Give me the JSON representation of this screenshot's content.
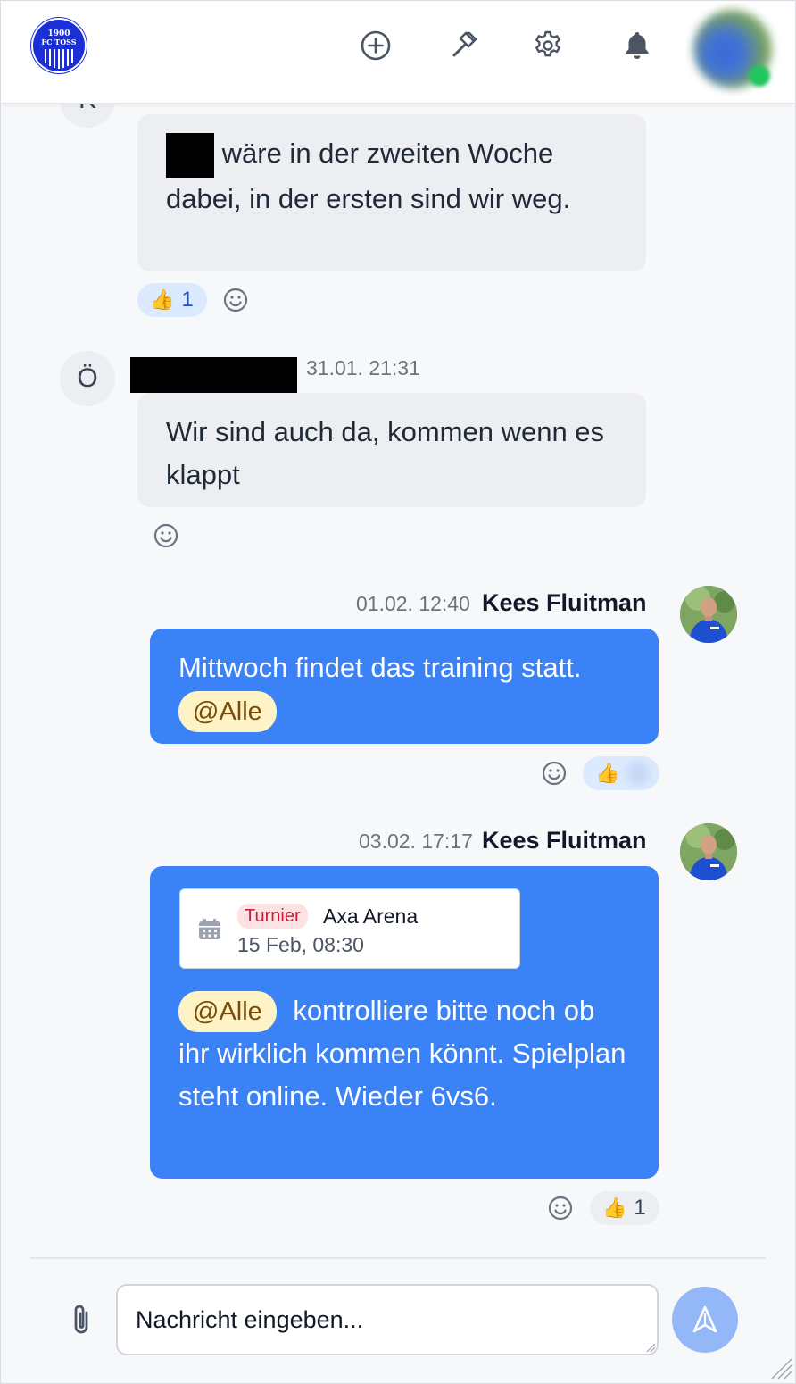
{
  "header": {
    "logo_text": "1900 FC TÖSS",
    "icons": [
      "plus-circle-icon",
      "hammer-icon",
      "gear-icon",
      "bell-icon"
    ]
  },
  "messages": [
    {
      "id": "m1",
      "avatar_letter": "K",
      "text_after_redaction": "wäre in der zweiten Woche dabei, in der ersten sind wir weg.",
      "reactions": [
        {
          "emoji": "👍",
          "count": "1"
        }
      ]
    },
    {
      "id": "m2",
      "avatar_letter": "Ö",
      "timestamp": "31.01. 21:31",
      "text": "Wir sind auch da, kommen wenn es klappt"
    },
    {
      "id": "m3",
      "author": "Kees Fluitman",
      "timestamp": "01.02. 12:40",
      "text": "Mittwoch findet das training statt.",
      "mention": "@Alle",
      "reactions": [
        {
          "emoji": "👍",
          "count": ""
        }
      ]
    },
    {
      "id": "m4",
      "author": "Kees Fluitman",
      "timestamp": "03.02. 17:17",
      "event": {
        "badge": "Turnier",
        "title": "Axa Arena",
        "date": "15 Feb, 08:30"
      },
      "mention": "@Alle",
      "text": "kontrolliere bitte noch ob ihr wirklich kommen könnt. Spielplan steht online. Wieder 6vs6.",
      "reactions": [
        {
          "emoji": "👍",
          "count": "1"
        }
      ]
    }
  ],
  "composer": {
    "placeholder": "Nachricht eingeben..."
  },
  "colors": {
    "outgoing_bubble": "#3b82f6",
    "incoming_bubble": "#eceef1",
    "mention_bg": "#fef3c7",
    "badge_bg": "#fde2e4",
    "logo": "#1a2fd6",
    "send_button": "#93b7f7"
  }
}
